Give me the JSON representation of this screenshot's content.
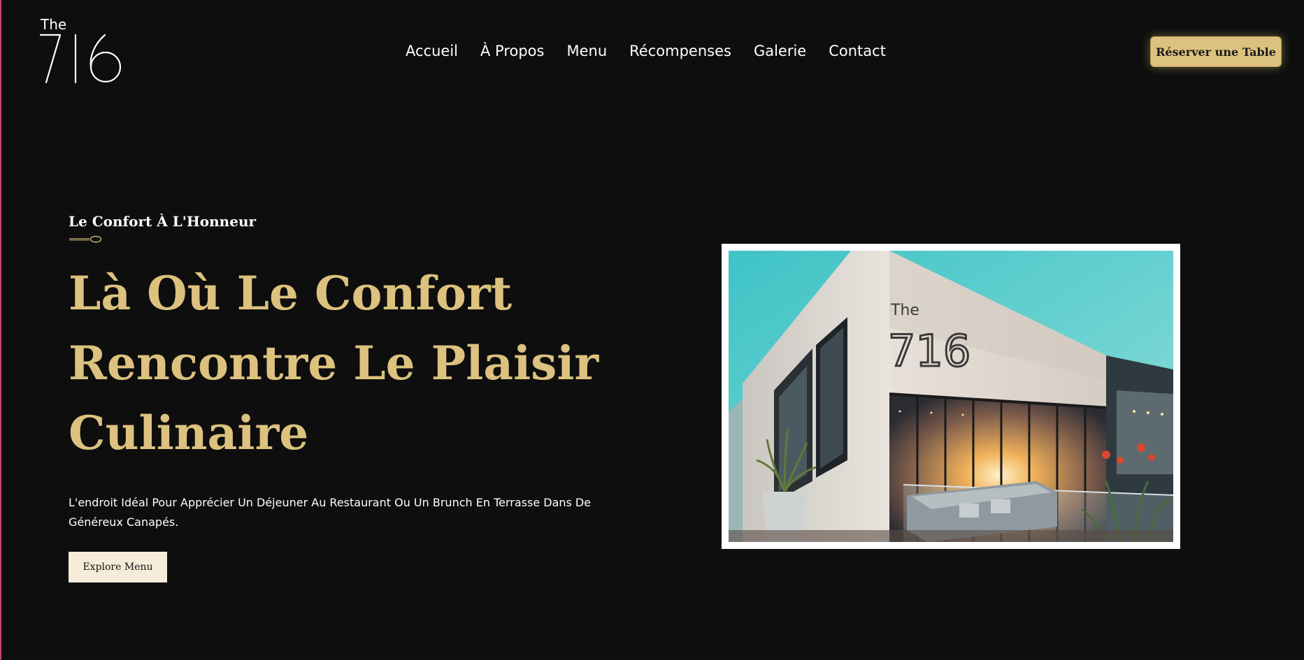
{
  "brand": {
    "logo_text_top": "The",
    "logo_text_main": "716"
  },
  "nav": {
    "items": [
      {
        "label": "Accueil"
      },
      {
        "label": "À Propos"
      },
      {
        "label": "Menu"
      },
      {
        "label": "Récompenses"
      },
      {
        "label": "Galerie"
      },
      {
        "label": "Contact"
      }
    ],
    "reserve_label": "Réserver une Table"
  },
  "hero": {
    "eyebrow": "Le Confort À L'Honneur",
    "headline_lines": [
      "Là Où Le Confort",
      "Rencontre Le Plaisir",
      "Culinaire"
    ],
    "description": "L'endroit Idéal Pour Apprécier Un Déjeuner Au Restaurant Ou Un Brunch En Terrasse Dans De Généreux Canapés.",
    "cta_label": "Explore Menu",
    "photo_sign_top": "The",
    "photo_sign_main": "716"
  },
  "colors": {
    "background": "#0e0e0e",
    "accent_gold": "#dcc27e",
    "cta_cream": "#f7ecd9",
    "text": "#ffffff"
  },
  "icons": {
    "brand": "logo-716",
    "divider": "spoon-icon"
  }
}
